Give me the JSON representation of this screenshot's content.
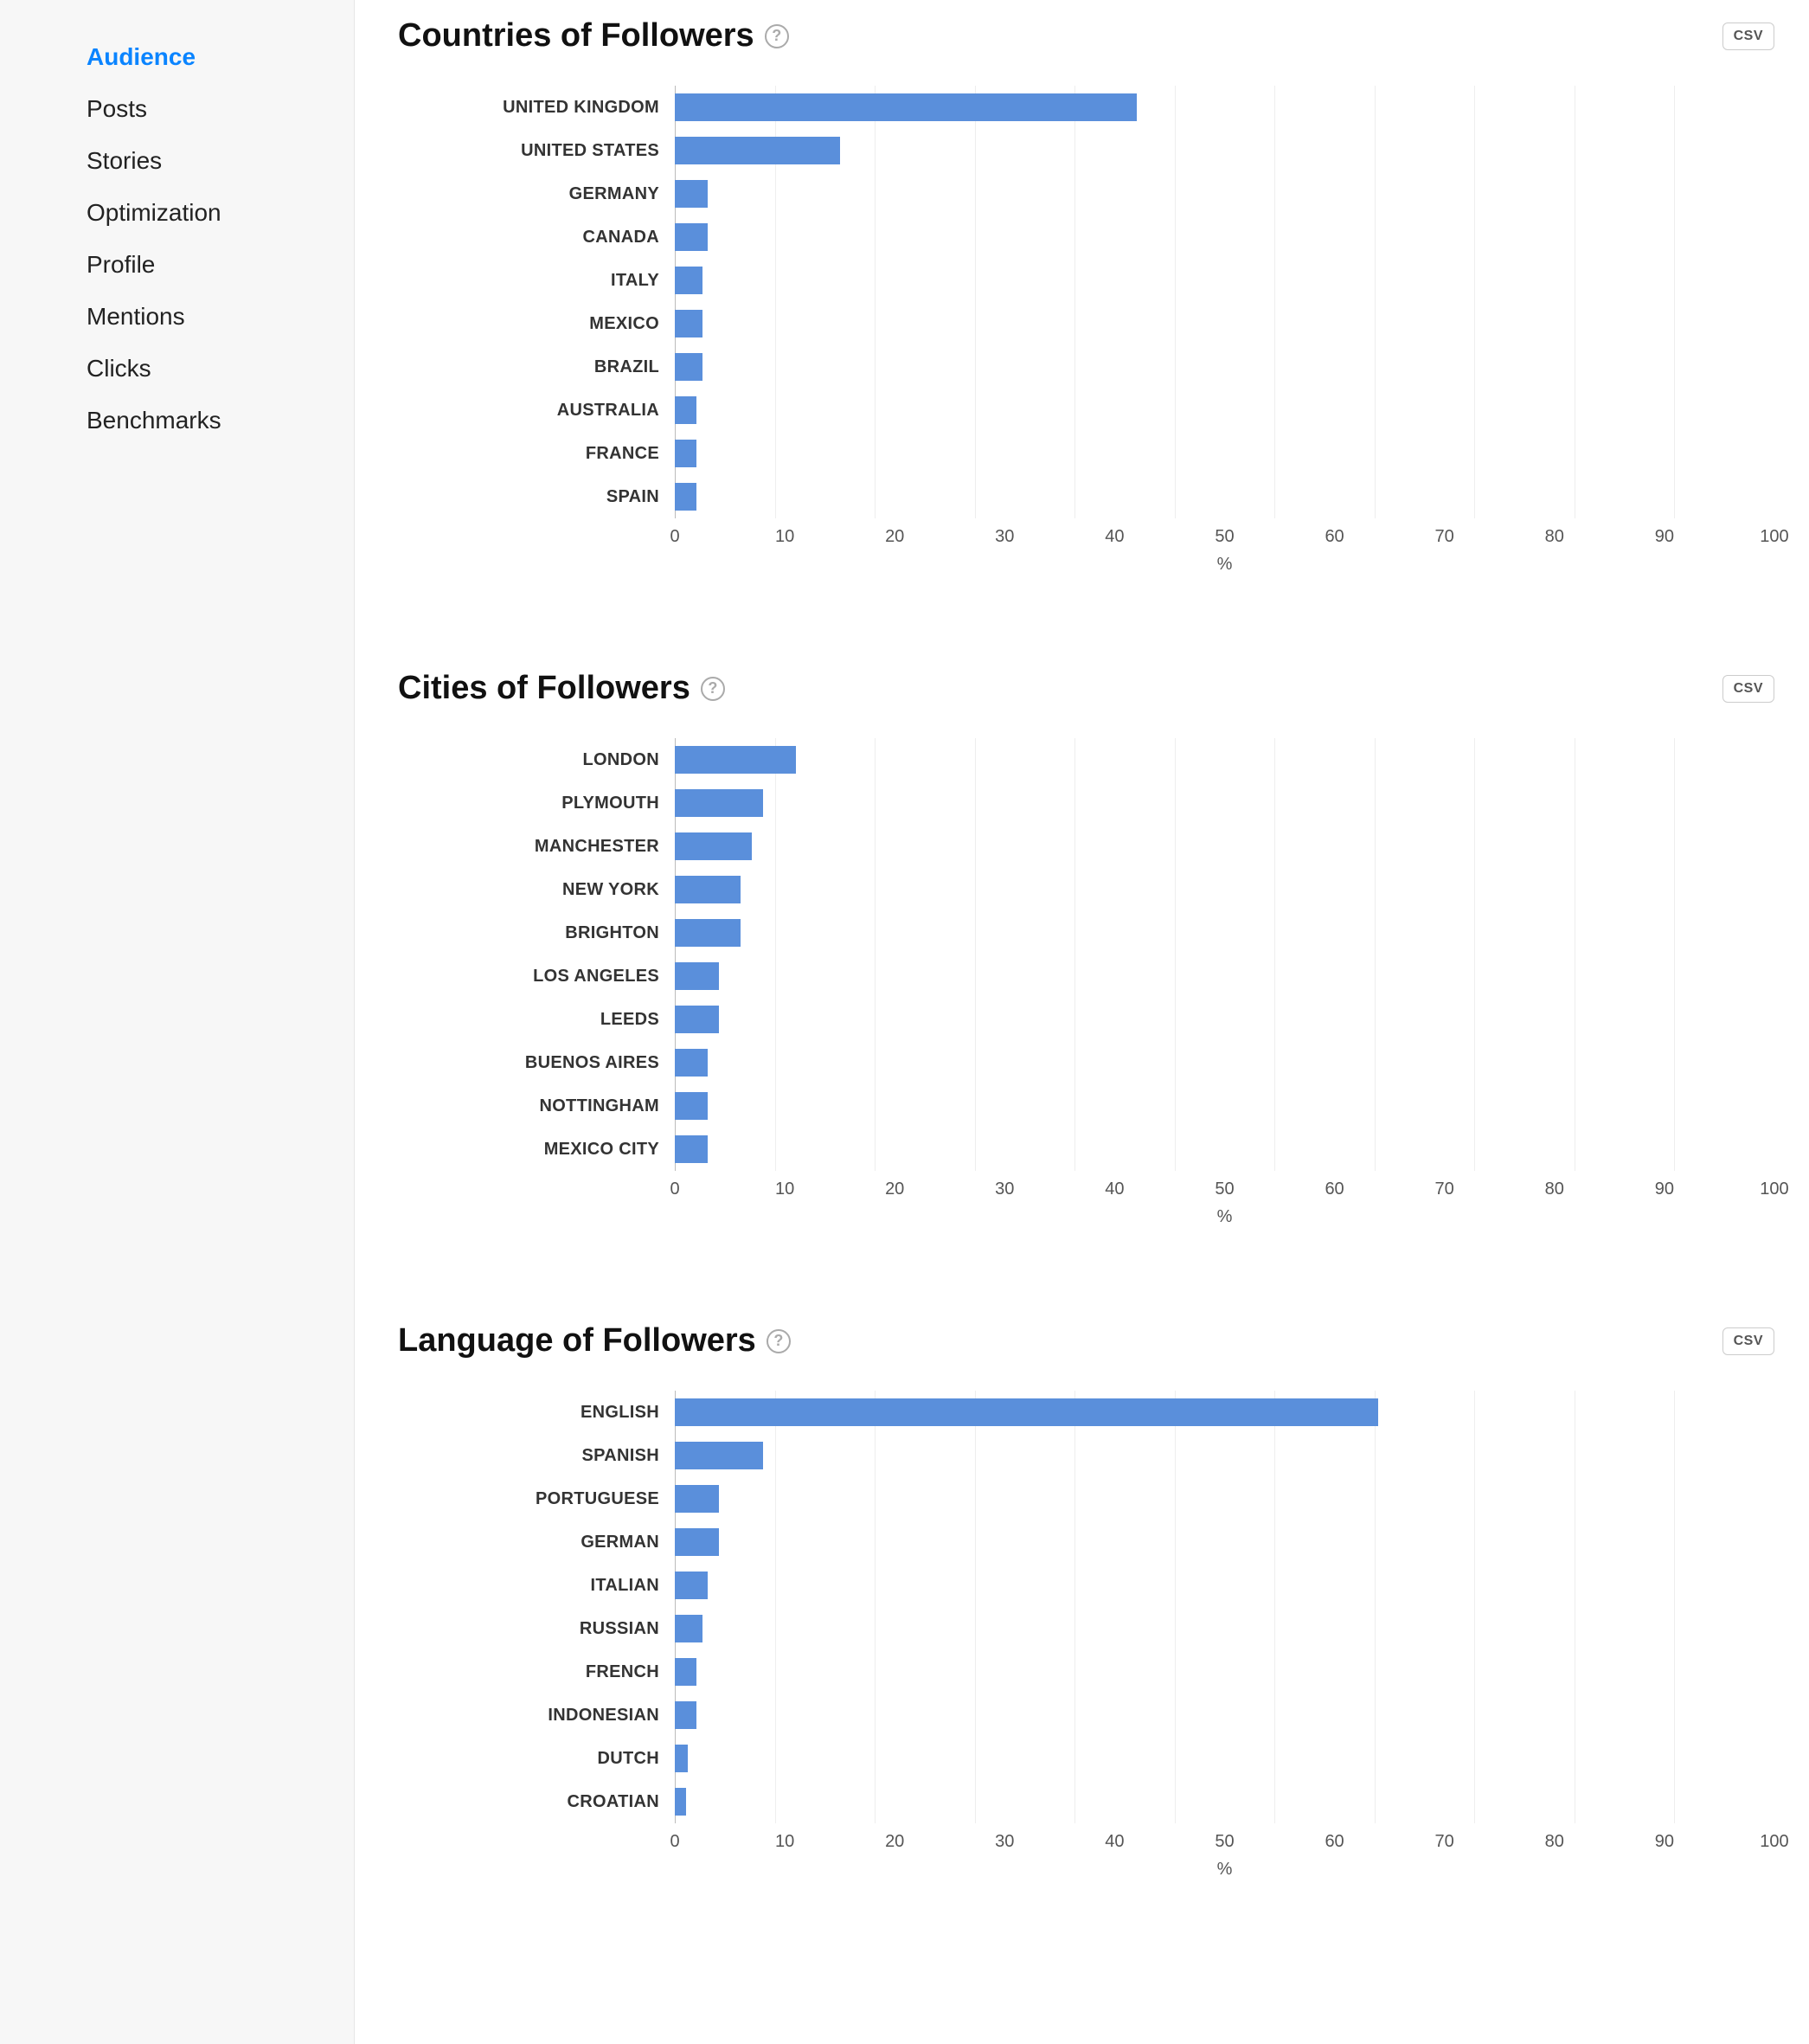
{
  "sidebar": {
    "items": [
      {
        "label": "Audience",
        "active": true
      },
      {
        "label": "Posts",
        "active": false
      },
      {
        "label": "Stories",
        "active": false
      },
      {
        "label": "Optimization",
        "active": false
      },
      {
        "label": "Profile",
        "active": false
      },
      {
        "label": "Mentions",
        "active": false
      },
      {
        "label": "Clicks",
        "active": false
      },
      {
        "label": "Benchmarks",
        "active": false
      }
    ]
  },
  "csv_label": "CSV",
  "help_glyph": "?",
  "x_ticks": [
    0,
    10,
    20,
    30,
    40,
    50,
    60,
    70,
    80,
    90,
    100
  ],
  "x_unit": "%",
  "charts": [
    {
      "title": "Countries of Followers",
      "categories": [
        "UNITED KINGDOM",
        "UNITED STATES",
        "GERMANY",
        "CANADA",
        "ITALY",
        "MEXICO",
        "BRAZIL",
        "AUSTRALIA",
        "FRANCE",
        "SPAIN"
      ],
      "values": [
        42,
        15,
        3,
        3,
        2.5,
        2.5,
        2.5,
        2,
        2,
        2
      ]
    },
    {
      "title": "Cities of Followers",
      "categories": [
        "LONDON",
        "PLYMOUTH",
        "MANCHESTER",
        "NEW YORK",
        "BRIGHTON",
        "LOS ANGELES",
        "LEEDS",
        "BUENOS AIRES",
        "NOTTINGHAM",
        "MEXICO CITY"
      ],
      "values": [
        11,
        8,
        7,
        6,
        6,
        4,
        4,
        3,
        3,
        3
      ]
    },
    {
      "title": "Language of Followers",
      "categories": [
        "ENGLISH",
        "SPANISH",
        "PORTUGUESE",
        "GERMAN",
        "ITALIAN",
        "RUSSIAN",
        "FRENCH",
        "INDONESIAN",
        "DUTCH",
        "CROATIAN"
      ],
      "values": [
        64,
        8,
        4,
        4,
        3,
        2.5,
        2,
        2,
        1.2,
        1
      ]
    }
  ],
  "chart_data": [
    {
      "type": "bar",
      "title": "Countries of Followers",
      "orientation": "horizontal",
      "xlabel": "%",
      "ylabel": "",
      "xlim": [
        0,
        100
      ],
      "categories": [
        "UNITED KINGDOM",
        "UNITED STATES",
        "GERMANY",
        "CANADA",
        "ITALY",
        "MEXICO",
        "BRAZIL",
        "AUSTRALIA",
        "FRANCE",
        "SPAIN"
      ],
      "values": [
        42,
        15,
        3,
        3,
        2.5,
        2.5,
        2.5,
        2,
        2,
        2
      ]
    },
    {
      "type": "bar",
      "title": "Cities of Followers",
      "orientation": "horizontal",
      "xlabel": "%",
      "ylabel": "",
      "xlim": [
        0,
        100
      ],
      "categories": [
        "LONDON",
        "PLYMOUTH",
        "MANCHESTER",
        "NEW YORK",
        "BRIGHTON",
        "LOS ANGELES",
        "LEEDS",
        "BUENOS AIRES",
        "NOTTINGHAM",
        "MEXICO CITY"
      ],
      "values": [
        11,
        8,
        7,
        6,
        6,
        4,
        4,
        3,
        3,
        3
      ]
    },
    {
      "type": "bar",
      "title": "Language of Followers",
      "orientation": "horizontal",
      "xlabel": "%",
      "ylabel": "",
      "xlim": [
        0,
        100
      ],
      "categories": [
        "ENGLISH",
        "SPANISH",
        "PORTUGUESE",
        "GERMAN",
        "ITALIAN",
        "RUSSIAN",
        "FRENCH",
        "INDONESIAN",
        "DUTCH",
        "CROATIAN"
      ],
      "values": [
        64,
        8,
        4,
        4,
        3,
        2.5,
        2,
        2,
        1.2,
        1
      ]
    }
  ]
}
